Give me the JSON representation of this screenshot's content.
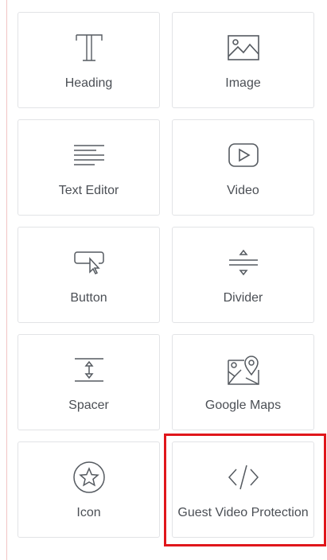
{
  "widgets": [
    {
      "label": "Heading",
      "icon": "heading-icon"
    },
    {
      "label": "Image",
      "icon": "image-icon"
    },
    {
      "label": "Text Editor",
      "icon": "text-editor-icon"
    },
    {
      "label": "Video",
      "icon": "video-icon"
    },
    {
      "label": "Button",
      "icon": "button-icon"
    },
    {
      "label": "Divider",
      "icon": "divider-icon"
    },
    {
      "label": "Spacer",
      "icon": "spacer-icon"
    },
    {
      "label": "Google Maps",
      "icon": "google-maps-icon"
    },
    {
      "label": "Icon",
      "icon": "star-icon"
    },
    {
      "label": "Guest Video Protection",
      "icon": "code-icon"
    }
  ],
  "colors": {
    "tile_border": "#e2e3e6",
    "icon": "#555a60",
    "label": "#4b4f55",
    "highlight": "#e0161b"
  }
}
